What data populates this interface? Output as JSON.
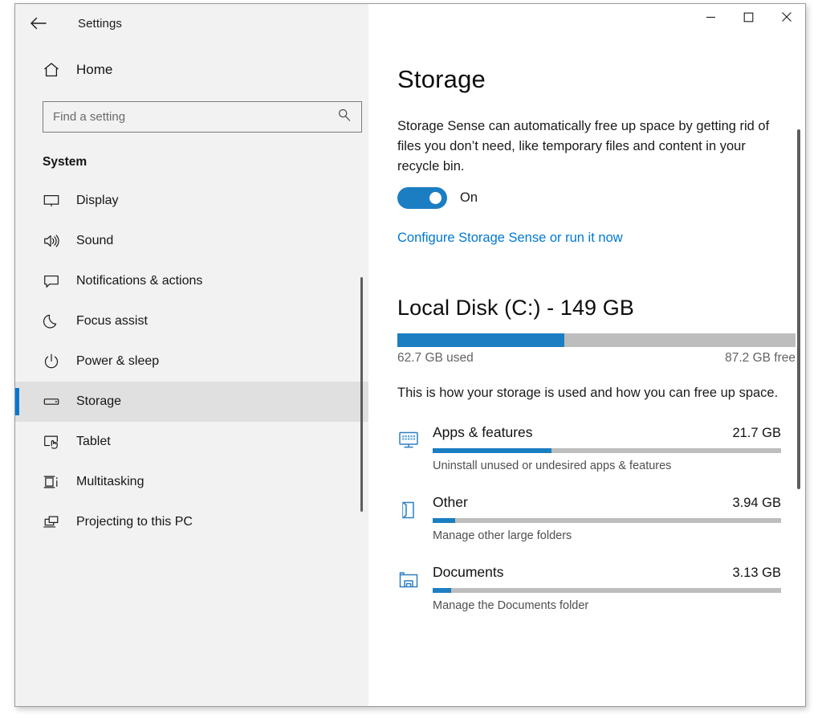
{
  "window": {
    "title": "Settings",
    "back_icon": "back-arrow-icon",
    "controls": {
      "minimize": "—",
      "maximize": "□",
      "close": "✕"
    }
  },
  "sidebar": {
    "home": {
      "label": "Home",
      "icon": "home-icon"
    },
    "search": {
      "placeholder": "Find a setting",
      "value": "",
      "icon": "search-icon"
    },
    "section_title": "System",
    "items": [
      {
        "label": "Display",
        "icon": "monitor-icon",
        "selected": false
      },
      {
        "label": "Sound",
        "icon": "speaker-icon",
        "selected": false
      },
      {
        "label": "Notifications & actions",
        "icon": "chat-bubble-icon",
        "selected": false
      },
      {
        "label": "Focus assist",
        "icon": "moon-icon",
        "selected": false
      },
      {
        "label": "Power & sleep",
        "icon": "power-icon",
        "selected": false
      },
      {
        "label": "Storage",
        "icon": "drive-icon",
        "selected": true
      },
      {
        "label": "Tablet",
        "icon": "tablet-touch-icon",
        "selected": false
      },
      {
        "label": "Multitasking",
        "icon": "multitasking-icon",
        "selected": false
      },
      {
        "label": "Projecting to this PC",
        "icon": "projecting-icon",
        "selected": false
      }
    ]
  },
  "main": {
    "page_title": "Storage",
    "storage_sense": {
      "description": "Storage Sense can automatically free up space by getting rid of files you don’t need, like temporary files and content in your recycle bin.",
      "toggle_state": "On",
      "toggle_on": true,
      "configure_link": "Configure Storage Sense or run it now"
    },
    "disk": {
      "title": "Local Disk (C:) - 149 GB",
      "used_label": "62.7 GB used",
      "free_label": "87.2 GB free",
      "used_percent": 42,
      "note": "This is how your storage is used and how you can free up space."
    },
    "categories": [
      {
        "name": "Apps & features",
        "size": "21.7 GB",
        "subtitle": "Uninstall unused or undesired apps & features",
        "percent": 34,
        "icon": "apps-monitor-icon"
      },
      {
        "name": "Other",
        "size": "3.94 GB",
        "subtitle": "Manage other large folders",
        "percent": 6.5,
        "icon": "page-fold-icon"
      },
      {
        "name": "Documents",
        "size": "3.13 GB",
        "subtitle": "Manage the Documents folder",
        "percent": 5.2,
        "icon": "documents-folder-icon"
      }
    ]
  },
  "colors": {
    "accent": "#0078d4",
    "bar_fill": "#1b7ec2",
    "bar_track": "#bdbdbd",
    "sidebar_bg": "#f2f2f2"
  }
}
